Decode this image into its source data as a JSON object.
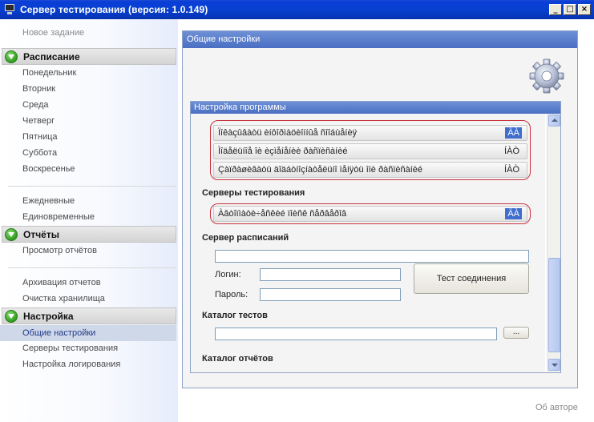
{
  "window": {
    "title": "Сервер тестирования (версия: 1.0.149)",
    "buttons": {
      "minimize": "_",
      "maximize": "□",
      "close": "×"
    }
  },
  "sidebar": {
    "new_task": "Новое задание",
    "schedule": {
      "header": "Расписание",
      "days": [
        "Понедельник",
        "Вторник",
        "Среда",
        "Четверг",
        "Пятница",
        "Суббота",
        "Воскресенье"
      ],
      "extra": [
        "Ежедневные",
        "Единовременные"
      ]
    },
    "reports": {
      "header": "Отчёты",
      "items": [
        "Просмотр отчётов",
        "Архивация отчетов",
        "Очистка хранилища"
      ]
    },
    "settings": {
      "header": "Настройка",
      "items": [
        "Общие настройки",
        "Серверы тестирования",
        "Настройка логирования"
      ],
      "selected": "Общие настройки"
    }
  },
  "main": {
    "title": "Общие настройки",
    "program_settings": {
      "title": "Настройка программы",
      "rows": [
        {
          "label": "Ïîêàçûâàòü èíôîðìàöèîííûå ñîîáùåíèÿ",
          "state": "ÄÀ",
          "active": true
        },
        {
          "label": "Ìîäåëüíîå îè èçìåíåíèè ðàñïèñàíèé",
          "state": "ÍÀÒ",
          "active": false
        },
        {
          "label": "Çàïðàøèâàòü äîäáòíîçíàòåëüíî ìåíÿòü îíè ðàñïèñàíèé",
          "state": "ÍÀÒ",
          "active": false
        }
      ],
      "test_servers_label": "Серверы тестирования",
      "test_server_row": {
        "label": "Àâòîïìàòè÷åñêèé ïîèñê ñåðâåðîâ",
        "state": "ÄÀ",
        "active": true
      },
      "schedule_server_label": "Сервер расписаний",
      "schedule_server_value": "",
      "login_label": "Логин:",
      "login_value": "",
      "password_label": "Пароль:",
      "password_value": "",
      "test_connection": "Тест соединения",
      "tests_catalog_label": "Каталог тестов",
      "tests_catalog_value": "",
      "browse": "...",
      "reports_catalog_label": "Каталог отчётов"
    }
  },
  "footer": {
    "about": "Об авторе"
  },
  "colors": {
    "accent": "#3f6ecf",
    "highlight": "#c8323c",
    "titlebar": "#0840cf"
  }
}
